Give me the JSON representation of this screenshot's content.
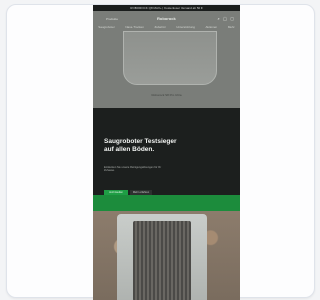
{
  "statusbar": {
    "text": "ROBOROCK Q8 MAX+ | Kostenloser Versand ab 50 €"
  },
  "header": {
    "menu_label": "Produkte",
    "brand": "Roborock",
    "icons": [
      "search-icon",
      "user-icon",
      "cart-icon"
    ],
    "nav": [
      "Saugroboter",
      "Nass-Trocken",
      "Zubehör",
      "Unterstützung",
      "Aktionen",
      "Mehr"
    ]
  },
  "product_caption": "Roborock S8 Pro Ultra",
  "hero": {
    "title": "Saugroboter Testsieger auf allen Böden.",
    "subtitle": "Entdecken Sie unsere Reinigungslösungen für Ihr Zuhause.",
    "primary_button": "Jetzt kaufen",
    "secondary_button": "Mehr erfahren"
  },
  "colors": {
    "accent_green": "#1f9e45",
    "hero_bg": "#1c1f1e",
    "header_bg": "#7a7d79",
    "green_bar": "#1c8c3c"
  }
}
